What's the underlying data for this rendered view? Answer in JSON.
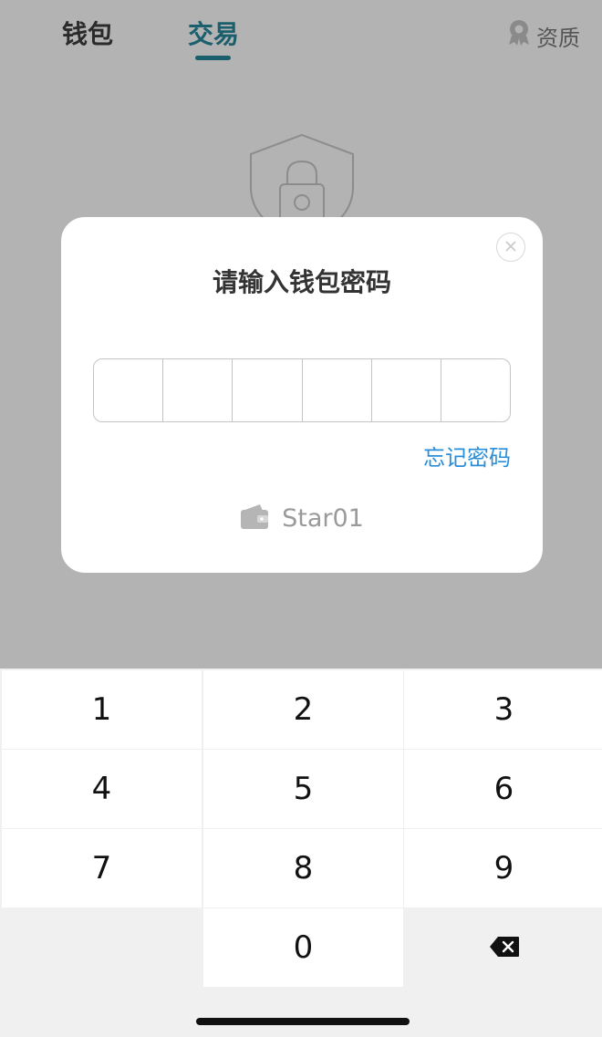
{
  "nav": {
    "tabs": [
      {
        "label": "钱包",
        "active": false
      },
      {
        "label": "交易",
        "active": true
      }
    ],
    "qualification": {
      "label": "资质",
      "icon": "award-ribbon-icon"
    },
    "accent_color": "#1a5f6b"
  },
  "background": {
    "icon": "shield-lock-icon"
  },
  "dialog": {
    "title": "请输入钱包密码",
    "pin_length": 6,
    "pin_entered": 0,
    "forgot_label": "忘记密码",
    "forgot_color": "#2a8ed9",
    "wallet_icon": "wallet-icon",
    "wallet_name": "Star01",
    "close_icon": "close-icon"
  },
  "keypad": {
    "keys": [
      "1",
      "2",
      "3",
      "4",
      "5",
      "6",
      "7",
      "8",
      "9",
      "",
      "0",
      "⌫"
    ],
    "backspace_icon": "backspace-icon"
  }
}
